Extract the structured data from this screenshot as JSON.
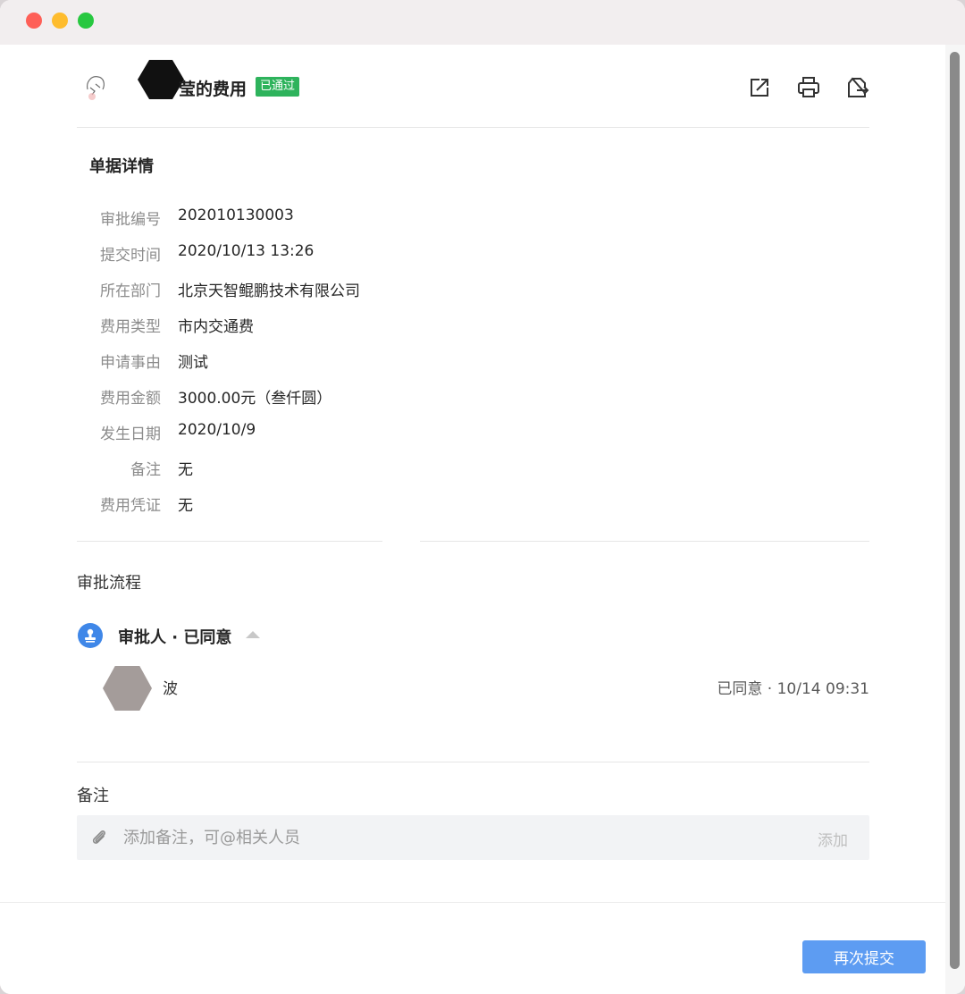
{
  "header": {
    "title": "莹的费用",
    "status_badge": "已通过",
    "icons": [
      "share-icon",
      "print-icon",
      "export-icon"
    ]
  },
  "details": {
    "section_title": "单据详情",
    "fields": [
      {
        "label": "审批编号",
        "value": "202010130003"
      },
      {
        "label": "提交时间",
        "value": "2020/10/13 13:26"
      },
      {
        "label": "所在部门",
        "value": "北京天智鲲鹏技术有限公司"
      },
      {
        "label": "费用类型",
        "value": "市内交通费"
      },
      {
        "label": "申请事由",
        "value": "测试"
      },
      {
        "label": "费用金额",
        "value": "3000.00元（叁仟圆）"
      },
      {
        "label": "发生日期",
        "value": "2020/10/9"
      },
      {
        "label": "备注",
        "value": "无"
      },
      {
        "label": "费用凭证",
        "value": "无"
      }
    ]
  },
  "flow": {
    "section_title": "审批流程",
    "step_label": "审批人 · 已同意",
    "approver_name": "波",
    "approval_status": "已同意 · 10/14 09:31"
  },
  "remark": {
    "section_title": "备注",
    "placeholder": "添加备注，可@相关人员",
    "add_label": "添加"
  },
  "footer": {
    "resubmit_label": "再次提交"
  },
  "colors": {
    "badge": "#2eb35c",
    "primary": "#5d9cf2",
    "flow_icon": "#3f87e8"
  }
}
